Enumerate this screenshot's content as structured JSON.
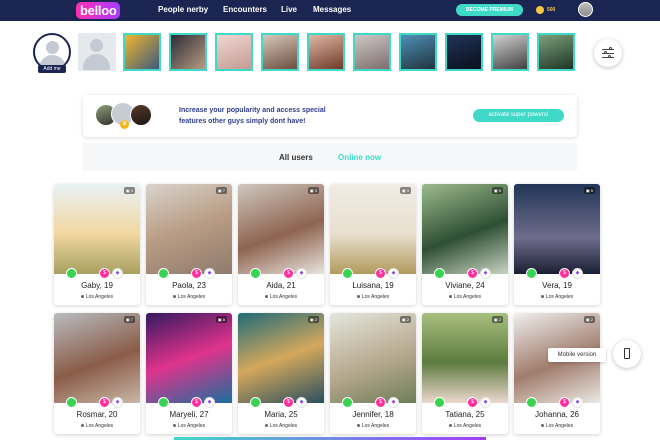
{
  "app": {
    "logo_text": "belloo"
  },
  "nav": {
    "items": [
      "People nerby",
      "Encounters",
      "Live",
      "Messages"
    ],
    "premium_label": "BECOME PREMIUM",
    "coins": "500"
  },
  "stories": {
    "add_me_label": "Add me",
    "thumb_colors": [
      "linear-gradient(135deg,#f2b52f,#3b5a7d)",
      "linear-gradient(135deg,#2c2c35,#b99a83)",
      "linear-gradient(160deg,#f0d6d1,#c59b94)",
      "linear-gradient(160deg,#d7c7b9,#6b4f3f)",
      "linear-gradient(160deg,#e1b7a3,#6e3b29)",
      "linear-gradient(160deg,#cdc7c6,#7d6e6d)",
      "linear-gradient(160deg,#4e8fb6,#20343e)",
      "linear-gradient(160deg,#203457,#0a0f1d)",
      "linear-gradient(160deg,#d2d2d2,#404040)",
      "linear-gradient(160deg,#7da07b,#1e3424)"
    ]
  },
  "promo": {
    "text": "Increase your popularity and access special features other guys simply dont have!",
    "button_label": "activate super powers!"
  },
  "tabs": {
    "all_users": "All users",
    "online_now": "Online now"
  },
  "cards": [
    {
      "name": "Gaby, 19",
      "location": "Los Angeles",
      "photos": "4",
      "bg": "linear-gradient(180deg,#e9f2f6 0%,#f2d7a1 55%,#a7a05f 100%)"
    },
    {
      "name": "Paola, 23",
      "location": "Los Angeles",
      "photos": "7",
      "bg": "linear-gradient(160deg,#d9d3cc 0%,#b89c83 50%,#8f7a6e 100%)"
    },
    {
      "name": "Aida, 21",
      "location": "Los Angeles",
      "photos": "3",
      "bg": "linear-gradient(160deg,#cfc7bf 0%,#8e6450 55%,#e9e3de 100%)"
    },
    {
      "name": "Luisana, 19",
      "location": "Los Angeles",
      "photos": "3",
      "bg": "linear-gradient(180deg,#f1ece4 0%,#e8dfcf 55%,#b29a5c 100%)"
    },
    {
      "name": "Viviane, 24",
      "location": "Los Angeles",
      "photos": "6",
      "bg": "linear-gradient(160deg,#9dbb8d 0%,#2e4f34 55%,#c8d3c1 100%)"
    },
    {
      "name": "Vera, 19",
      "location": "Los Angeles",
      "photos": "5",
      "bg": "linear-gradient(180deg,#223657 0%,#6f6c8c 60%,#1a1f33 100%)"
    },
    {
      "name": "Rosmar, 20",
      "location": "Los Angeles",
      "photos": "7",
      "bg": "linear-gradient(160deg,#b8bcc0 0%,#8a5c48 55%,#c9b8a8 100%)"
    },
    {
      "name": "Maryeli, 27",
      "location": "Los Angeles",
      "photos": "8",
      "bg": "linear-gradient(160deg,#33195f 0%,#e0338c 50%,#1b6f9e 100%)"
    },
    {
      "name": "Maria, 25",
      "location": "Los Angeles",
      "photos": "2",
      "bg": "linear-gradient(160deg,#1f6a78 0%,#d4a85c 50%,#2b4f5e 100%)"
    },
    {
      "name": "Jennifer, 18",
      "location": "Los Angeles",
      "photos": "2",
      "bg": "linear-gradient(160deg,#e4e6dc 0%,#b7a98f 55%,#6e7d57 100%)"
    },
    {
      "name": "Tatiana, 25",
      "location": "Los Angeles",
      "photos": "2",
      "bg": "linear-gradient(180deg,#a7bf80 0%,#5d7b3e 55%,#ecd8cf 100%)"
    },
    {
      "name": "Johanna, 26",
      "location": "Los Angeles",
      "photos": "2",
      "bg": "linear-gradient(160deg,#efefef 0%,#a07c6c 55%,#ece9e4 100%)"
    }
  ],
  "side": {
    "mobile_version_label": "Mobile version"
  },
  "colors": {
    "nav_bg": "#1b2551",
    "accent": "#3fd9c7",
    "online": "#39d353",
    "pink": "#ff2f9d"
  }
}
